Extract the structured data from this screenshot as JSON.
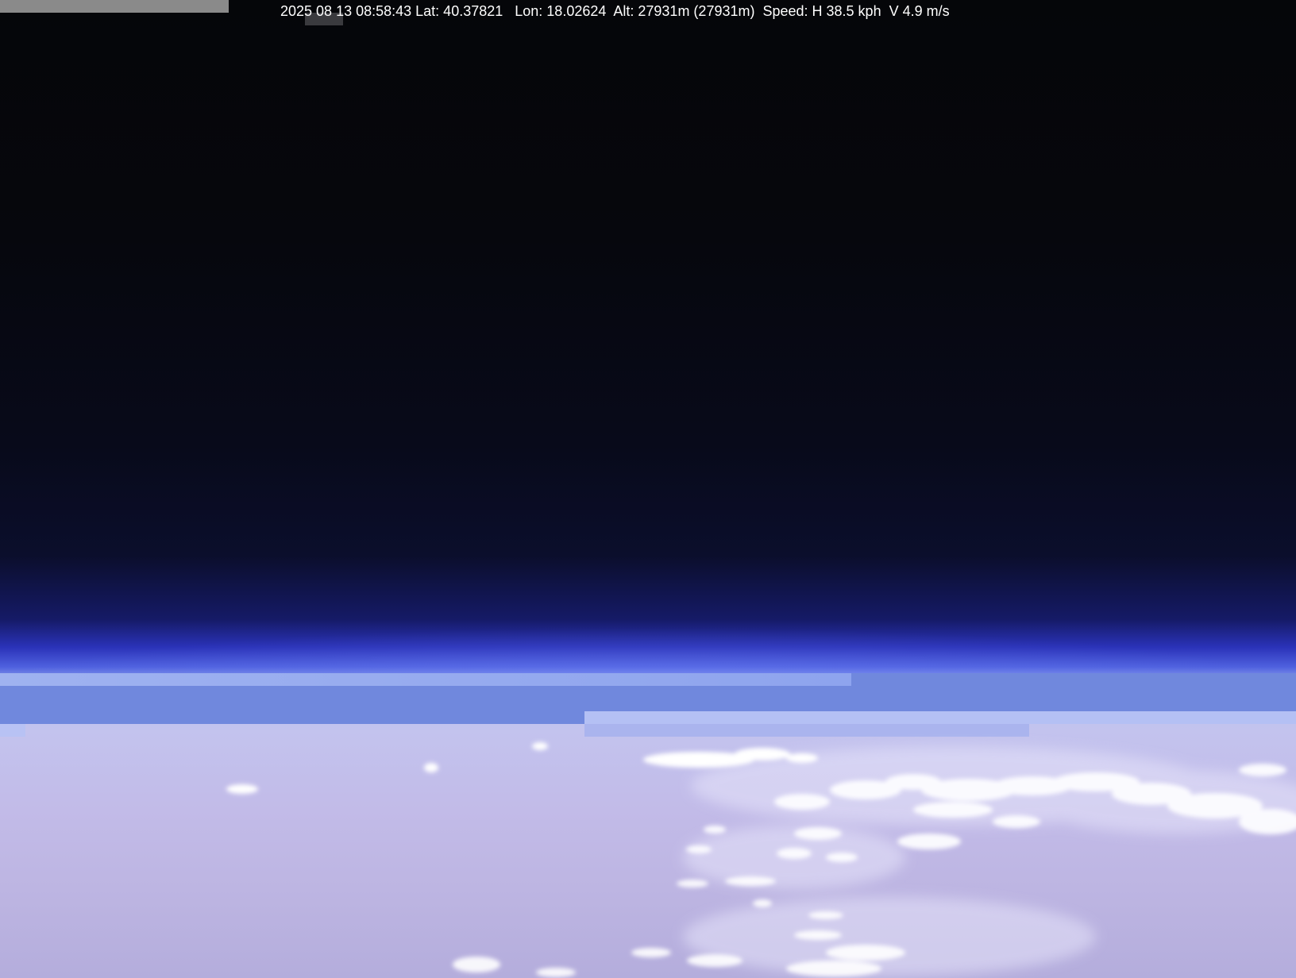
{
  "telemetry": {
    "text": "2025 08 13 08:58:43 Lat: 40.37821   Lon: 18.02624  Alt: 27931m (27931m)  Speed: H 38.5 kph  V 4.9 m/s"
  },
  "colors": {
    "space": "#05060a",
    "horizon_blue": "#2a32b8",
    "glitch_band": "#7088dd",
    "earth_haze": "#c2bbe8",
    "cloud": "#ffffff"
  }
}
